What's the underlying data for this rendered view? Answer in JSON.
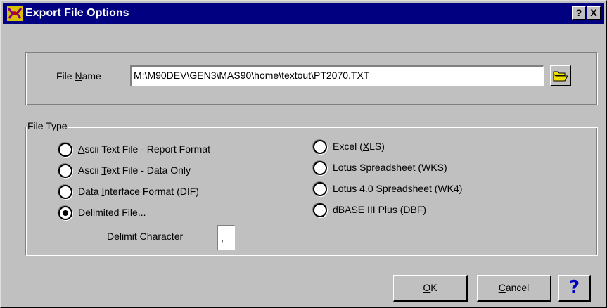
{
  "window": {
    "title": "Export File Options",
    "help_glyph": "?",
    "close_glyph": "X",
    "icon": "mas90-app-icon"
  },
  "file_name": {
    "label_underlined": "N",
    "label_before": "File ",
    "label_after": "ame",
    "value": "M:\\M90DEV\\GEN3\\MAS90\\home\\textout\\PT2070.TXT",
    "browse_icon": "folder-open-icon"
  },
  "file_type": {
    "legend": "File Type",
    "options": [
      {
        "before": "",
        "key": "A",
        "after": "scii Text File - Report Format",
        "checked": false
      },
      {
        "before": "Ascii ",
        "key": "T",
        "after": "ext File - Data Only",
        "checked": false
      },
      {
        "before": "Data ",
        "key": "I",
        "after": "nterface Format (DIF)",
        "checked": false
      },
      {
        "before": "",
        "key": "D",
        "after": "elimited File...",
        "checked": true
      },
      {
        "before": "Excel (",
        "key": "X",
        "after": "LS)",
        "checked": false
      },
      {
        "before": "Lotus Spreadsheet (W",
        "key": "K",
        "after": "S)",
        "checked": false
      },
      {
        "before": "Lotus 4.0 Spreadsheet (WK",
        "key": "4",
        "after": ")",
        "checked": false
      },
      {
        "before": "dBASE III Plus (DB",
        "key": "F",
        "after": ")",
        "checked": false
      }
    ],
    "delimit_label": "Delimit Character",
    "delimit_value": ","
  },
  "buttons": {
    "ok_key": "O",
    "ok_rest": "K",
    "cancel_key": "C",
    "cancel_rest": "ancel",
    "help_glyph": "?",
    "help_icon": "help-question-icon"
  }
}
